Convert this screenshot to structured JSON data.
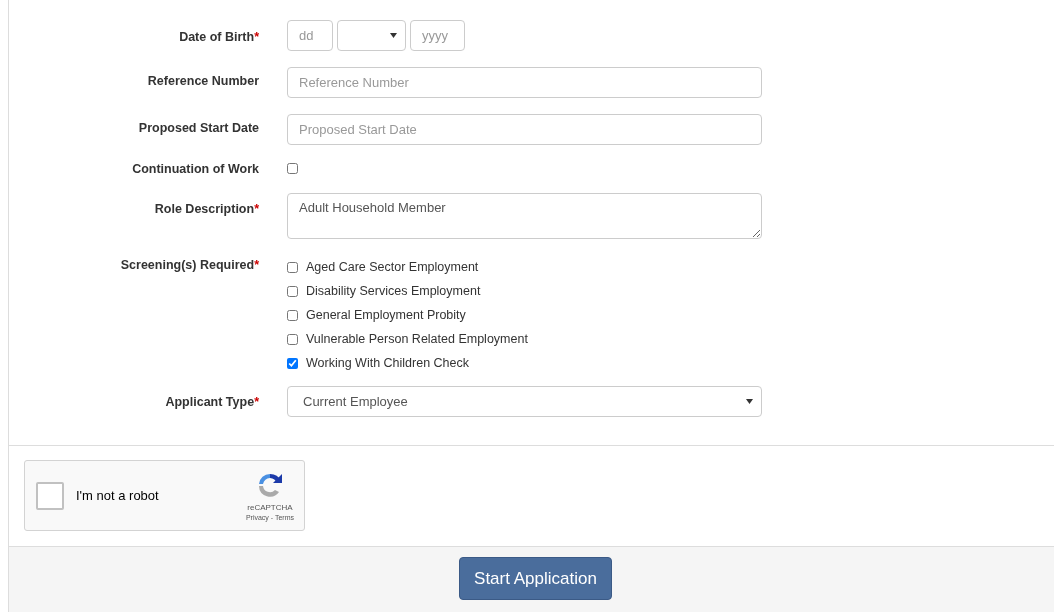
{
  "form": {
    "fields": [
      {
        "kind": "date",
        "label": "Date of Birth",
        "required_mark": "*",
        "day_placeholder": "dd",
        "year_placeholder": "yyyy"
      },
      {
        "kind": "text",
        "label": "Reference Number",
        "placeholder": "Reference Number"
      },
      {
        "kind": "text",
        "label": "Proposed Start Date",
        "placeholder": "Proposed Start Date"
      },
      {
        "kind": "checkbox",
        "label": "Continuation of Work",
        "checked": false
      },
      {
        "kind": "textarea",
        "label": "Role Description",
        "required_mark": "*",
        "value": "Adult Household Member"
      },
      {
        "kind": "checkbox_group",
        "label": "Screening(s) Required",
        "required_mark": "*",
        "options": [
          {
            "label": "Aged Care Sector Employment",
            "checked": false
          },
          {
            "label": "Disability Services Employment",
            "checked": false
          },
          {
            "label": "General Employment Probity",
            "checked": false
          },
          {
            "label": "Vulnerable Person Related Employment",
            "checked": false
          },
          {
            "label": "Working With Children Check",
            "checked": true
          }
        ]
      },
      {
        "kind": "select",
        "label": "Applicant Type",
        "required_mark": "*",
        "value": "Current Employee"
      }
    ]
  },
  "captcha": {
    "label": "I'm not a robot",
    "brand": "reCAPTCHA",
    "links": "Privacy - Terms",
    "checked": false
  },
  "footer": {
    "button": "Start Application"
  }
}
